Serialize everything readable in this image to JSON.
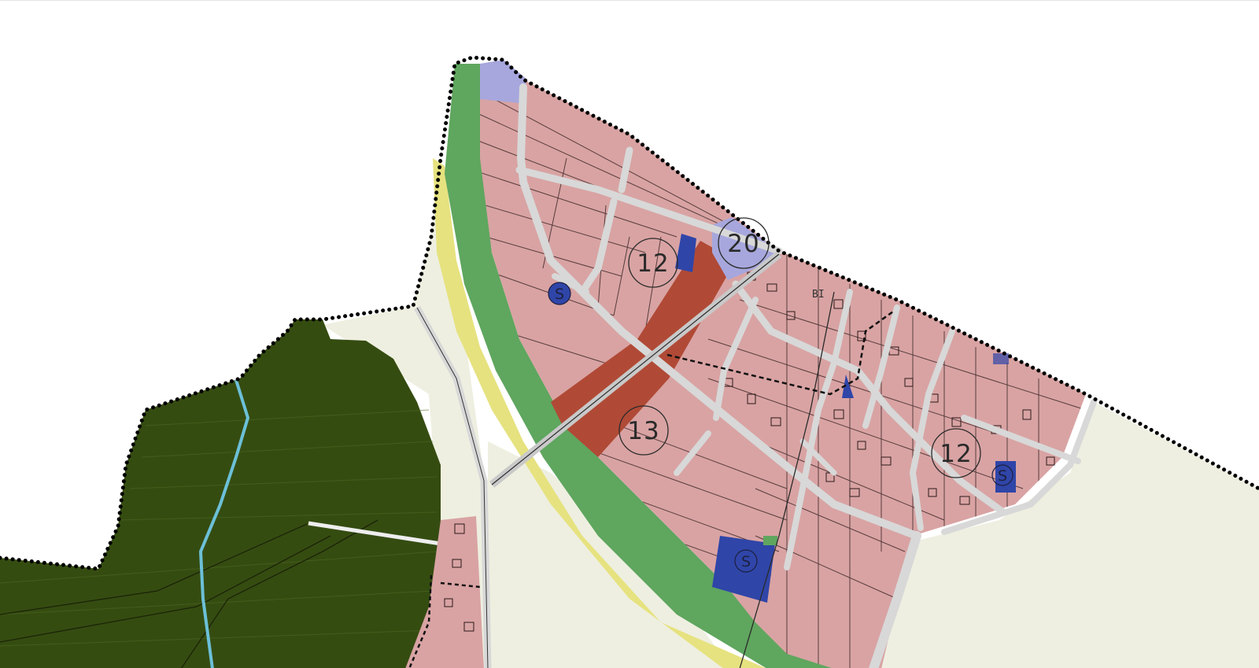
{
  "map": {
    "zone_labels": [
      "12",
      "20",
      "13",
      "12"
    ],
    "service_markers": [
      "S",
      "S",
      "S"
    ],
    "parcel_code": "BI",
    "colors": {
      "residential": "#d9a3a3",
      "forest": "#354c11",
      "buffer_green": "#5fa65f",
      "buffer_yellow": "#e6e27f",
      "agricultural": "#eeefe0",
      "mixed_use": "#b04a36",
      "public_light": "#a7a7dd",
      "public_blue": "#2f45a8",
      "road": "#d8d8d8",
      "stream": "#6cc0d8",
      "boundary": "#000000"
    }
  }
}
